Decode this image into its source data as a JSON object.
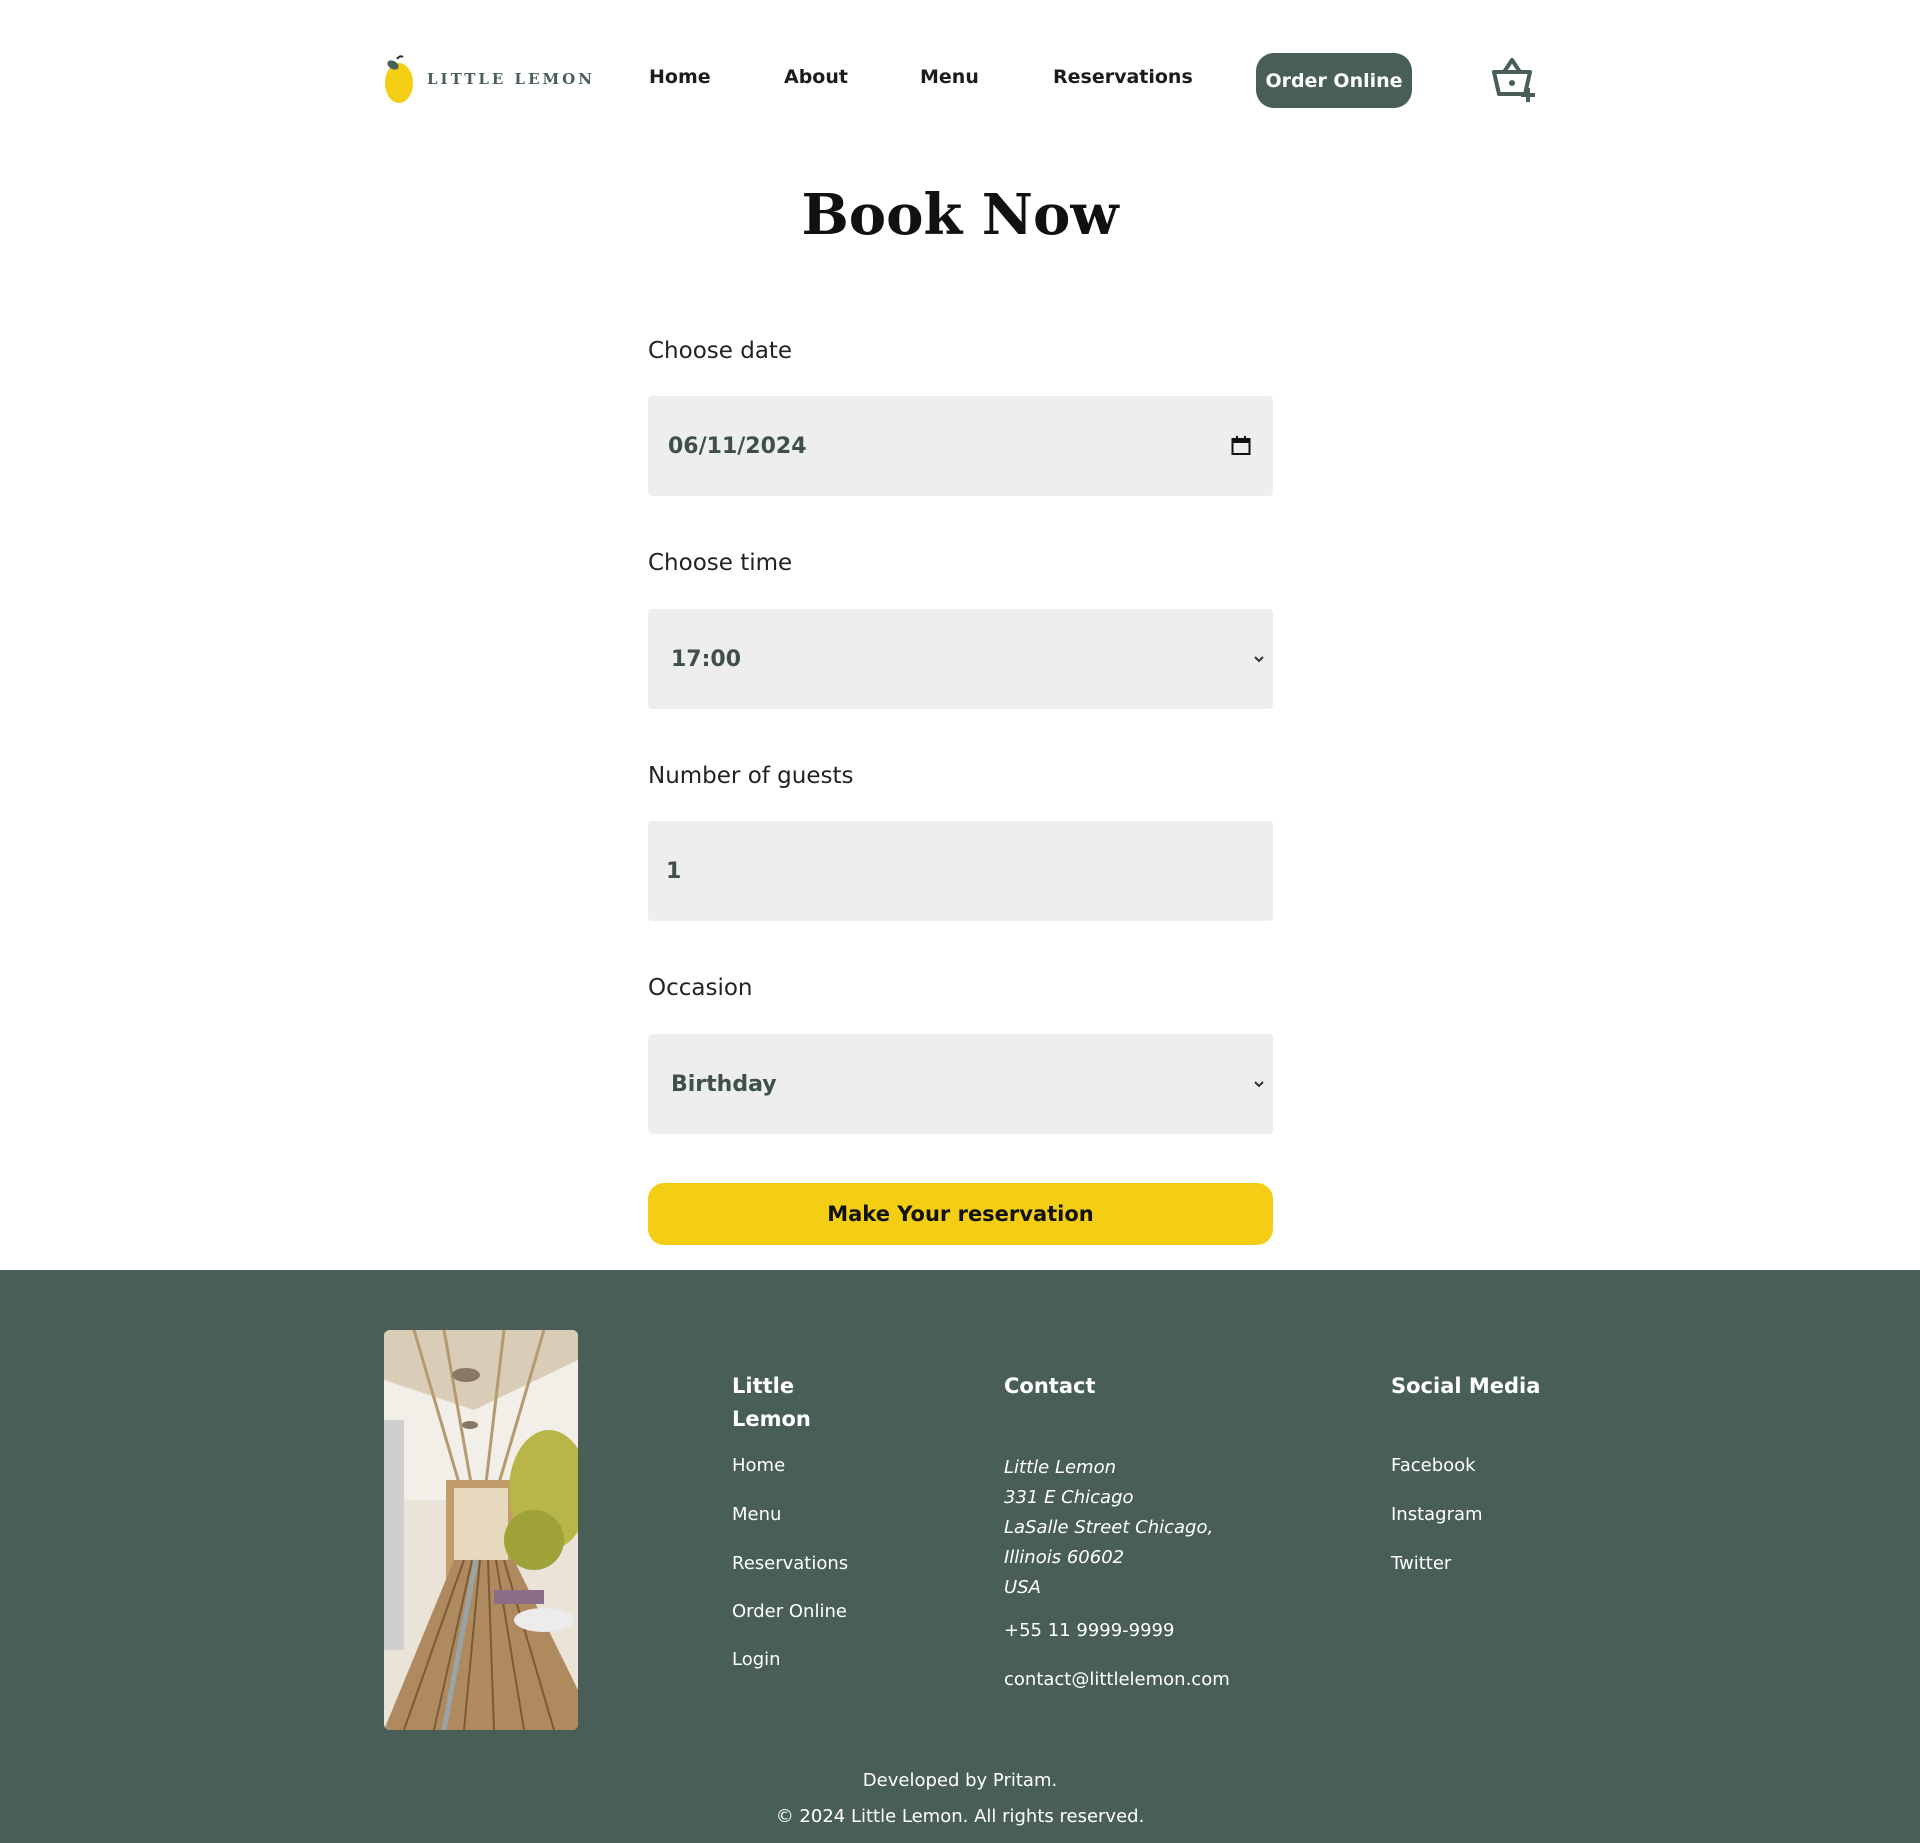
{
  "brand": {
    "name": "LITTLE LEMON"
  },
  "nav": {
    "items": [
      "Home",
      "About",
      "Menu",
      "Reservations"
    ],
    "order_button": "Order Online",
    "cart_icon": "basket-plus-icon"
  },
  "page": {
    "title": "Book Now"
  },
  "form": {
    "date": {
      "label": "Choose date",
      "value": "06/11/2024",
      "icon": "calendar-icon"
    },
    "time": {
      "label": "Choose time",
      "value": "17:00"
    },
    "guests": {
      "label": "Number of guests",
      "value": "1"
    },
    "occasion": {
      "label": "Occasion",
      "value": "Birthday"
    },
    "submit": "Make Your reservation"
  },
  "footer": {
    "nav_heading": "Little Lemon",
    "nav_links": [
      "Home",
      "Menu",
      "Reservations",
      "Order Online",
      "Login"
    ],
    "contact_heading": "Contact",
    "address": [
      "Little Lemon",
      "331 E Chicago",
      "LaSalle Street Chicago,",
      "Illinois 60602",
      "USA"
    ],
    "phone": "+55 11 9999-9999",
    "email": "contact@littlelemon.com",
    "social_heading": "Social Media",
    "social_links": [
      "Facebook",
      "Instagram",
      "Twitter"
    ],
    "developed_by": "Developed by Pritam.",
    "copyright": "© 2024 Little Lemon. All rights reserved."
  },
  "colors": {
    "primary_green": "#495e57",
    "accent_yellow": "#f4ce14",
    "field_bg": "#edeeed"
  }
}
